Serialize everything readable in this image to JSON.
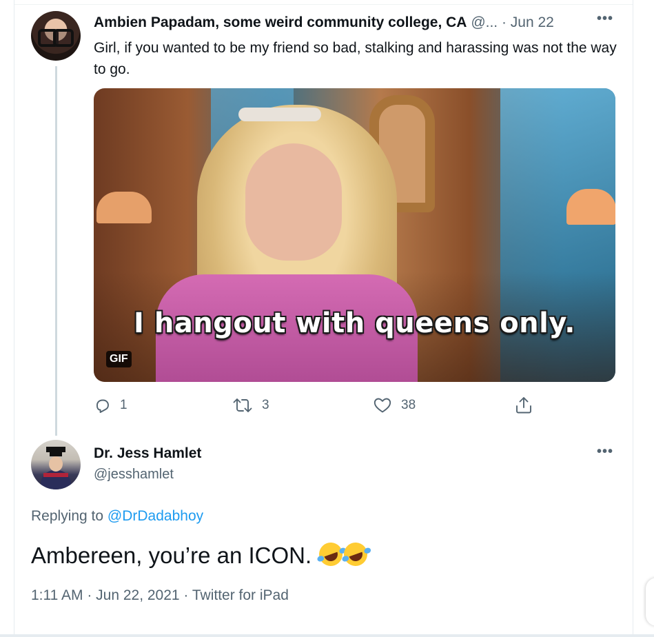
{
  "tweet1": {
    "name": "Ambien Papadam, some weird community college, CA",
    "handle": "@...",
    "date": "· Jun 22",
    "text": "Girl, if you wanted to be my friend so bad, stalking and harassing was not the way to go.",
    "gif": {
      "caption": "I hangout with queens only.",
      "badge": "GIF"
    },
    "actions": {
      "replies": "1",
      "retweets": "3",
      "likes": "38"
    },
    "more": "•••"
  },
  "tweet2": {
    "name": "Dr. Jess Hamlet",
    "handle": "@jesshamlet",
    "replying_prefix": "Replying to ",
    "replying_to": "@DrDadabhoy",
    "text": "Ambereen, you’re an ICON.",
    "meta": "1:11 AM · Jun 22, 2021 · Twitter for iPad",
    "more": "•••"
  },
  "icons": {
    "reply": "reply-icon",
    "retweet": "retweet-icon",
    "like": "heart-icon",
    "share": "share-icon",
    "emoji": "rolling-on-floor-laughing-emoji"
  },
  "colors": {
    "text": "#0f1419",
    "secondary": "#536471",
    "link": "#1d9bf0",
    "thread_line": "#cfd9de"
  }
}
